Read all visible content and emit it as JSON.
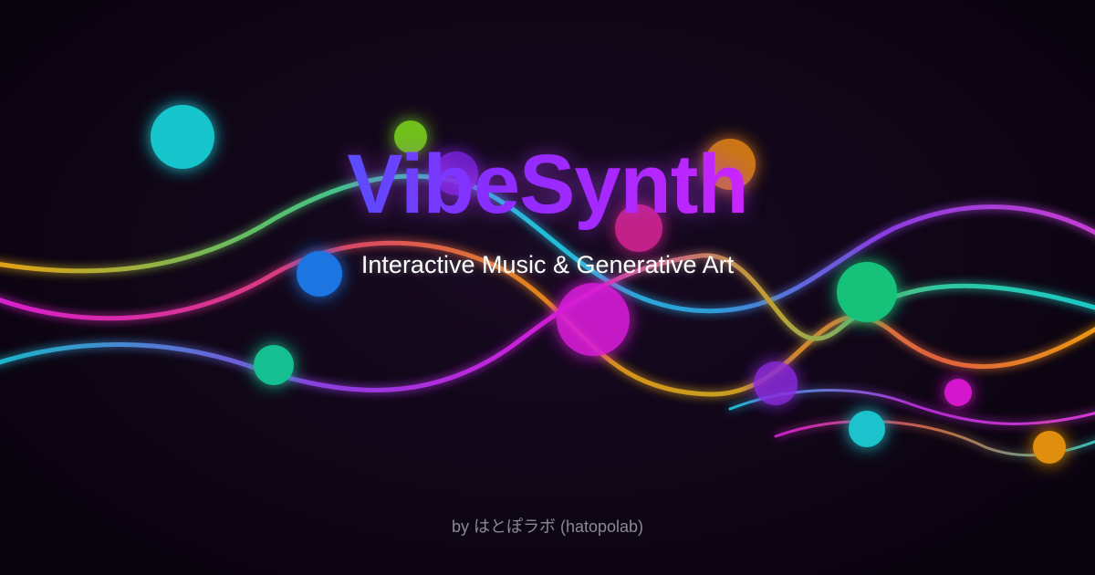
{
  "title": "VibeSynth",
  "subtitle": "Interactive Music & Generative Art",
  "credit": "by はとぽラボ (hatopolab)",
  "palette": {
    "background": "#0c0410",
    "cyan": "#16c9d0",
    "blue": "#1f7ae0",
    "violet": "#9b2cff",
    "magenta": "#e11ad8",
    "orange": "#e88a10",
    "green": "#10c070",
    "lime": "#6fc51a"
  }
}
